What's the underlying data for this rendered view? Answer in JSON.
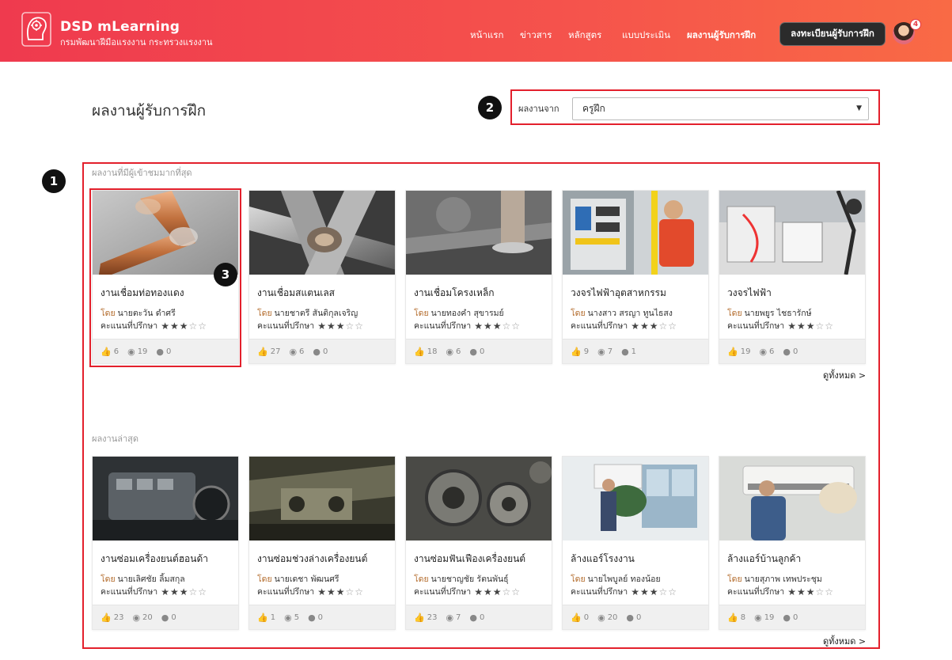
{
  "brand": {
    "title": "DSD mLearning",
    "subtitle": "กรมพัฒนาฝีมือแรงงาน กระทรวงแรงงาน"
  },
  "nav": {
    "items": [
      {
        "label": "หน้าแรก",
        "active": false
      },
      {
        "label": "ข่าวสาร",
        "active": false
      },
      {
        "label": "หลักสูตร",
        "active": false
      },
      {
        "label": "แบบประเมิน",
        "active": false
      },
      {
        "label": "ผลงานผู้รับการฝึก",
        "active": true
      }
    ],
    "register_label": "ลงทะเบียนผู้รับการฝึก",
    "notification_count": "4"
  },
  "page": {
    "title": "ผลงานผู้รับการฝึก",
    "filter_label": "ผลงานจาก",
    "filter_value": "ครูฝึก"
  },
  "markers": [
    "1",
    "2",
    "3"
  ],
  "sections": [
    {
      "label": "ผลงานที่มีผู้เข้าชมมากที่สุด",
      "see_all": "ดูทั้งหมด >",
      "cards": [
        {
          "title": "งานเชื่อมท่อทองแดง",
          "by": "โดย",
          "author": "นายตะวัน ดำศรี",
          "score_label": "คะแนนที่ปรึกษา",
          "rating": 3,
          "likes": "6",
          "views": "19",
          "comments": "0",
          "image": "copper-pipe-weld"
        },
        {
          "title": "งานเชื่อมสแตนเลส",
          "by": "โดย",
          "author": "นายชาตรี สันติกุลเจริญ",
          "score_label": "คะแนนที่ปรึกษา",
          "rating": 3,
          "likes": "27",
          "views": "6",
          "comments": "0",
          "image": "stainless-weld"
        },
        {
          "title": "งานเชื่อมโครงเหล็ก",
          "by": "โดย",
          "author": "นายทองคำ สุขารมย์",
          "score_label": "คะแนนที่ปรึกษา",
          "rating": 3,
          "likes": "18",
          "views": "6",
          "comments": "0",
          "image": "steel-frame-weld"
        },
        {
          "title": "วงจรไฟฟ้าอุตสาหกรรม",
          "by": "โดย",
          "author": "นางสาว สรญา ทูนไธสง",
          "score_label": "คะแนนที่ปรึกษา",
          "rating": 3,
          "likes": "9",
          "views": "7",
          "comments": "1",
          "image": "industrial-circuit"
        },
        {
          "title": "วงจรไฟฟ้า",
          "by": "โดย",
          "author": "นายพยูร ไชธารักษ์",
          "score_label": "คะแนนที่ปรึกษา",
          "rating": 3,
          "likes": "19",
          "views": "6",
          "comments": "0",
          "image": "electric-circuit"
        }
      ]
    },
    {
      "label": "ผลงานล่าสุด",
      "see_all": "ดูทั้งหมด >",
      "cards": [
        {
          "title": "งานซ่อมเครื่องยนต์ฮอนด้า",
          "by": "โดย",
          "author": "นายเลิศชัย ลิ้มสกุล",
          "score_label": "คะแนนที่ปรึกษา",
          "rating": 3,
          "likes": "23",
          "views": "20",
          "comments": "0",
          "image": "honda-engine"
        },
        {
          "title": "งานซ่อมช่วงล่างเครื่องยนต์",
          "by": "โดย",
          "author": "นายเดชา พัฒนศรี",
          "score_label": "คะแนนที่ปรึกษา",
          "rating": 3,
          "likes": "1",
          "views": "5",
          "comments": "0",
          "image": "undercarriage"
        },
        {
          "title": "งานซ่อมฟันเฟืองเครื่องยนต์",
          "by": "โดย",
          "author": "นายชาญชัย รัตนพันธุ์",
          "score_label": "คะแนนที่ปรึกษา",
          "rating": 3,
          "likes": "23",
          "views": "7",
          "comments": "0",
          "image": "engine-gears"
        },
        {
          "title": "ล้างแอร์โรงงาน",
          "by": "โดย",
          "author": "นายไพบูลย์ ทองน้อย",
          "score_label": "คะแนนที่ปรึกษา",
          "rating": 3,
          "likes": "0",
          "views": "20",
          "comments": "0",
          "image": "factory-ac-cleaning"
        },
        {
          "title": "ล้างแอร์บ้านลูกค้า",
          "by": "โดย",
          "author": "นายสุภาพ เทพประชุม",
          "score_label": "คะแนนที่ปรึกษา",
          "rating": 3,
          "likes": "8",
          "views": "19",
          "comments": "0",
          "image": "home-ac-cleaning"
        }
      ]
    }
  ],
  "colors": {
    "header_start": "#ef3a4e",
    "header_end": "#f96a45",
    "highlight": "#e3202c",
    "register_bg": "#2b2b2b"
  }
}
